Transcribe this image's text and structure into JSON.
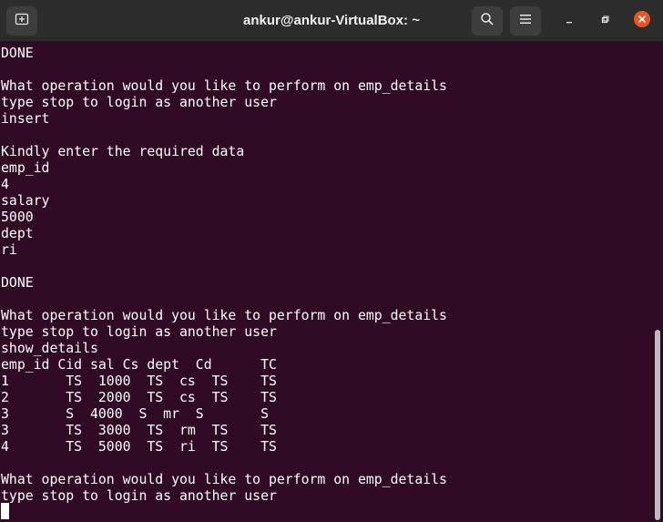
{
  "window": {
    "title": "ankur@ankur-VirtualBox: ~",
    "new_tab_icon": "new-tab-icon",
    "search_icon": "search-icon",
    "menu_icon": "hamburger-menu-icon",
    "minimize_icon": "minimize-icon",
    "maximize_icon": "maximize-icon",
    "close_icon": "close-icon",
    "close_color": "#e95420"
  },
  "terminal": {
    "background": "#300a24",
    "foreground": "#ffffff",
    "lines": [
      "DONE",
      "",
      "What operation would you like to perform on emp_details",
      "type stop to login as another user",
      "insert",
      "",
      "Kindly enter the required data",
      "emp_id",
      "4",
      "salary",
      "5000",
      "dept",
      "ri",
      "",
      "DONE",
      "",
      "What operation would you like to perform on emp_details",
      "type stop to login as another user",
      "show_details",
      "emp_id Cid sal Cs dept  Cd      TC",
      "1       TS  1000  TS  cs  TS    TS",
      "2       TS  2000  TS  cs  TS    TS",
      "3       S  4000  S  mr  S       S",
      "3       TS  3000  TS  rm  TS    TS",
      "4       TS  5000  TS  ri  TS    TS",
      "",
      "What operation would you like to perform on emp_details",
      "type stop to login as another user"
    ]
  }
}
